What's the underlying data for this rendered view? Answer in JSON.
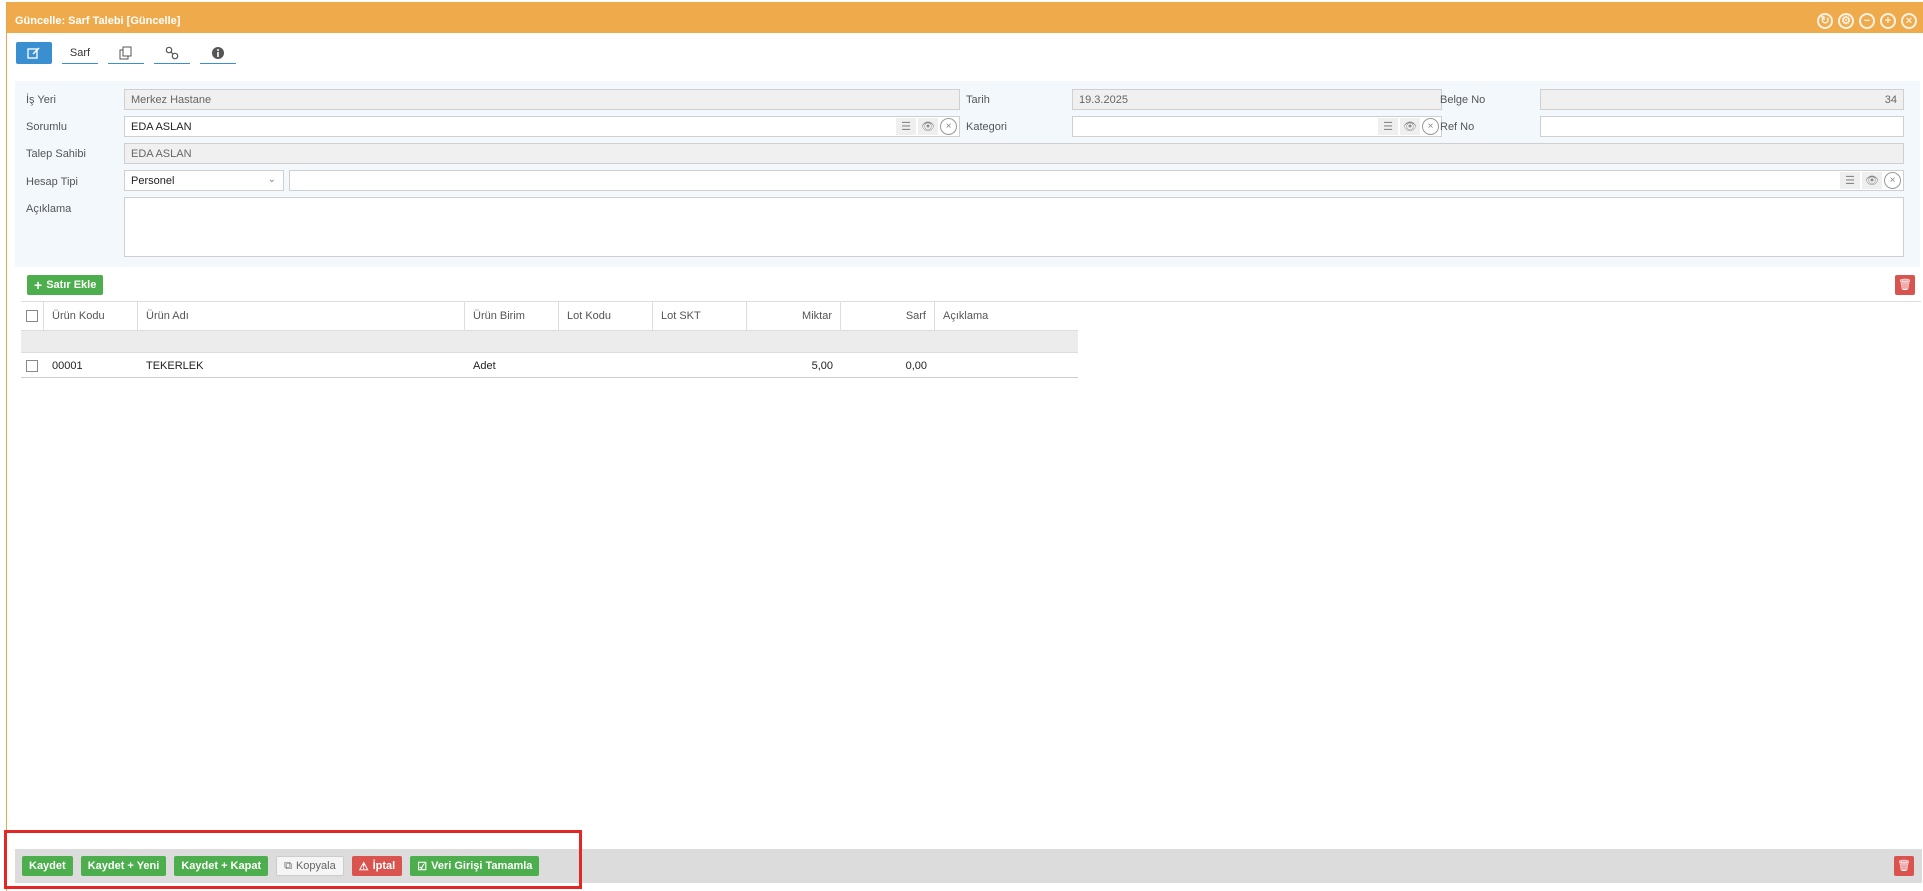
{
  "window": {
    "title": "Güncelle: Sarf Talebi [Güncelle]",
    "controls": [
      "refresh-icon",
      "gear-icon",
      "minimize-icon",
      "maximize-icon",
      "close-icon"
    ]
  },
  "toolbar": {
    "tabs": [
      {
        "icon": "edit-icon"
      },
      {
        "label": "Sarf"
      },
      {
        "icon": "copy-icon"
      },
      {
        "icon": "link-icon"
      },
      {
        "icon": "info-icon"
      }
    ]
  },
  "form": {
    "is_yeri": {
      "label": "İş Yeri",
      "value": "Merkez Hastane"
    },
    "tarih": {
      "label": "Tarih",
      "value": "19.3.2025"
    },
    "belge_no": {
      "label": "Belge No",
      "value": "34"
    },
    "sorumlu": {
      "label": "Sorumlu",
      "value": "EDA ASLAN"
    },
    "kategori": {
      "label": "Kategori",
      "value": ""
    },
    "ref_no": {
      "label": "Ref No",
      "value": ""
    },
    "talep_sahibi": {
      "label": "Talep Sahibi",
      "value": "EDA ASLAN"
    },
    "hesap_tipi": {
      "label": "Hesap Tipi",
      "value": "Personel",
      "secondary": ""
    },
    "aciklama": {
      "label": "Açıklama",
      "value": ""
    }
  },
  "grid": {
    "add_row_label": "Satır Ekle",
    "columns": [
      "Ürün Kodu",
      "Ürün Adı",
      "Ürün Birim",
      "Lot Kodu",
      "Lot SKT",
      "Miktar",
      "Sarf",
      "Açıklama"
    ],
    "rows": [
      {
        "urun_kodu": "00001",
        "urun_adi": "TEKERLEK",
        "urun_birim": "Adet",
        "lot_kodu": "",
        "lot_skt": "",
        "miktar": "5,00",
        "sarf": "0,00",
        "aciklama": ""
      }
    ]
  },
  "footer": {
    "kaydet": "Kaydet",
    "kaydet_yeni": "Kaydet + Yeni",
    "kaydet_kapat": "Kaydet + Kapat",
    "kopyala": "Kopyala",
    "iptal": "İptal",
    "veri_girisi": "Veri Girişi Tamamla"
  },
  "colors": {
    "title_bar": "#efaa4c",
    "primary": "#3a8fd0",
    "success": "#4cae4c",
    "danger": "#d9534f",
    "highlight": "#e32626"
  }
}
